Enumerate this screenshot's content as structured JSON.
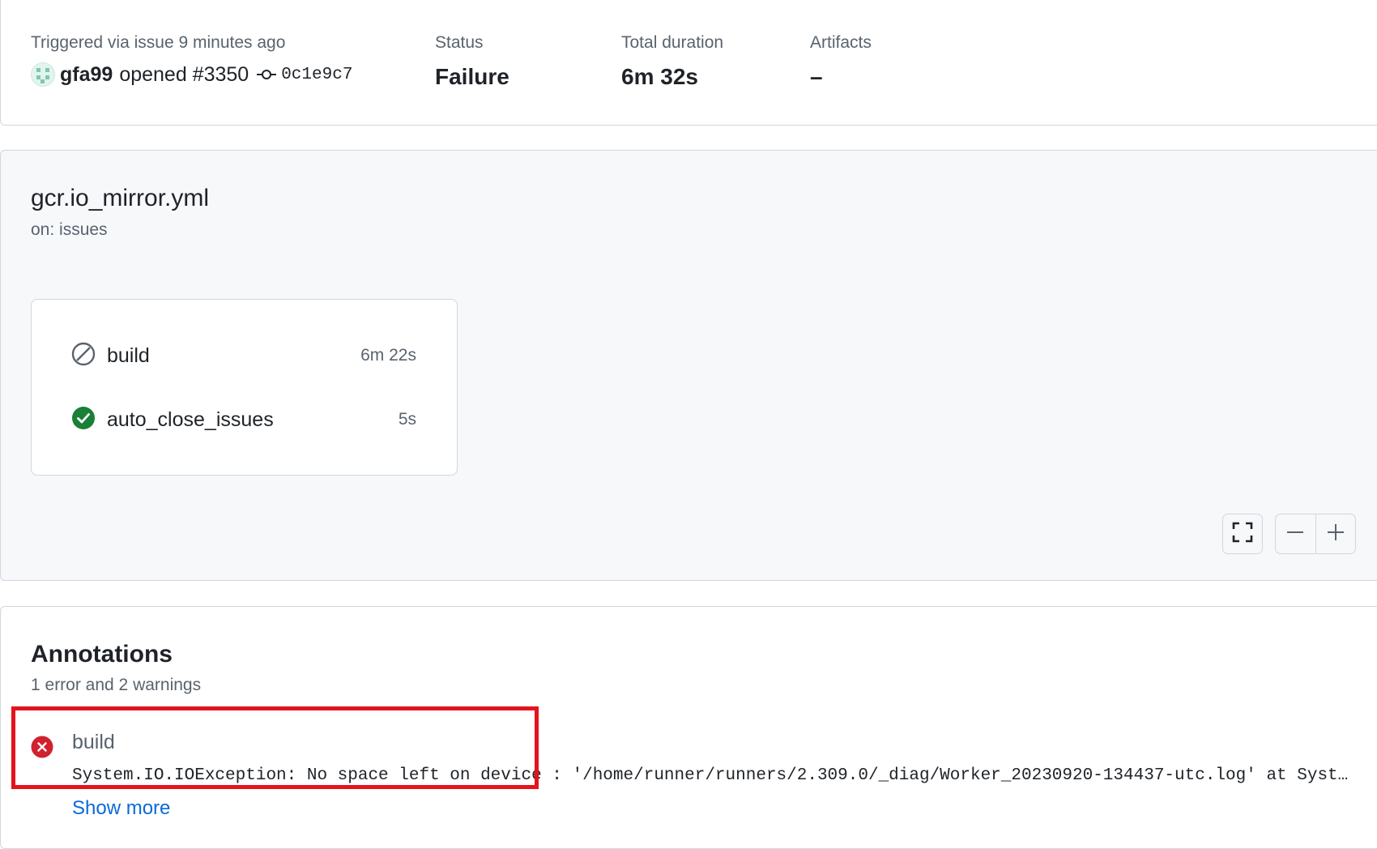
{
  "summary": {
    "trigger_label": "Triggered via issue 9 minutes ago",
    "actor": "gfa99",
    "action": "opened #3350",
    "commit_sha": "0c1e9c7",
    "status_label": "Status",
    "status_value": "Failure",
    "duration_label": "Total duration",
    "duration_value": "6m 32s",
    "artifacts_label": "Artifacts",
    "artifacts_value": "–"
  },
  "workflow": {
    "file": "gcr.io_mirror.yml",
    "trigger": "on: issues",
    "jobs": [
      {
        "name": "build",
        "duration": "6m 22s",
        "status": "skipped",
        "icon": "skip-icon"
      },
      {
        "name": "auto_close_issues",
        "duration": "5s",
        "status": "success",
        "icon": "check-circle-icon"
      }
    ]
  },
  "annotations": {
    "title": "Annotations",
    "subtitle": "1 error and 2 warnings",
    "items": [
      {
        "job": "build",
        "level": "error",
        "icon": "x-circle-icon",
        "message": "System.IO.IOException: No space left on device : '/home/runner/runners/2.309.0/_diag/Worker_20230920-134437-utc.log' at System.IO.RandomAccess.WriteAtOffset(SafeFileHandle handle, ReadOnlySpan`1 buffer, Int64 fileOffset)",
        "show_more": "Show more"
      }
    ]
  },
  "colors": {
    "error": "#cf222e",
    "success": "#1a7f37",
    "muted": "#59636e",
    "link": "#0969da",
    "highlight": "#e3141c"
  }
}
